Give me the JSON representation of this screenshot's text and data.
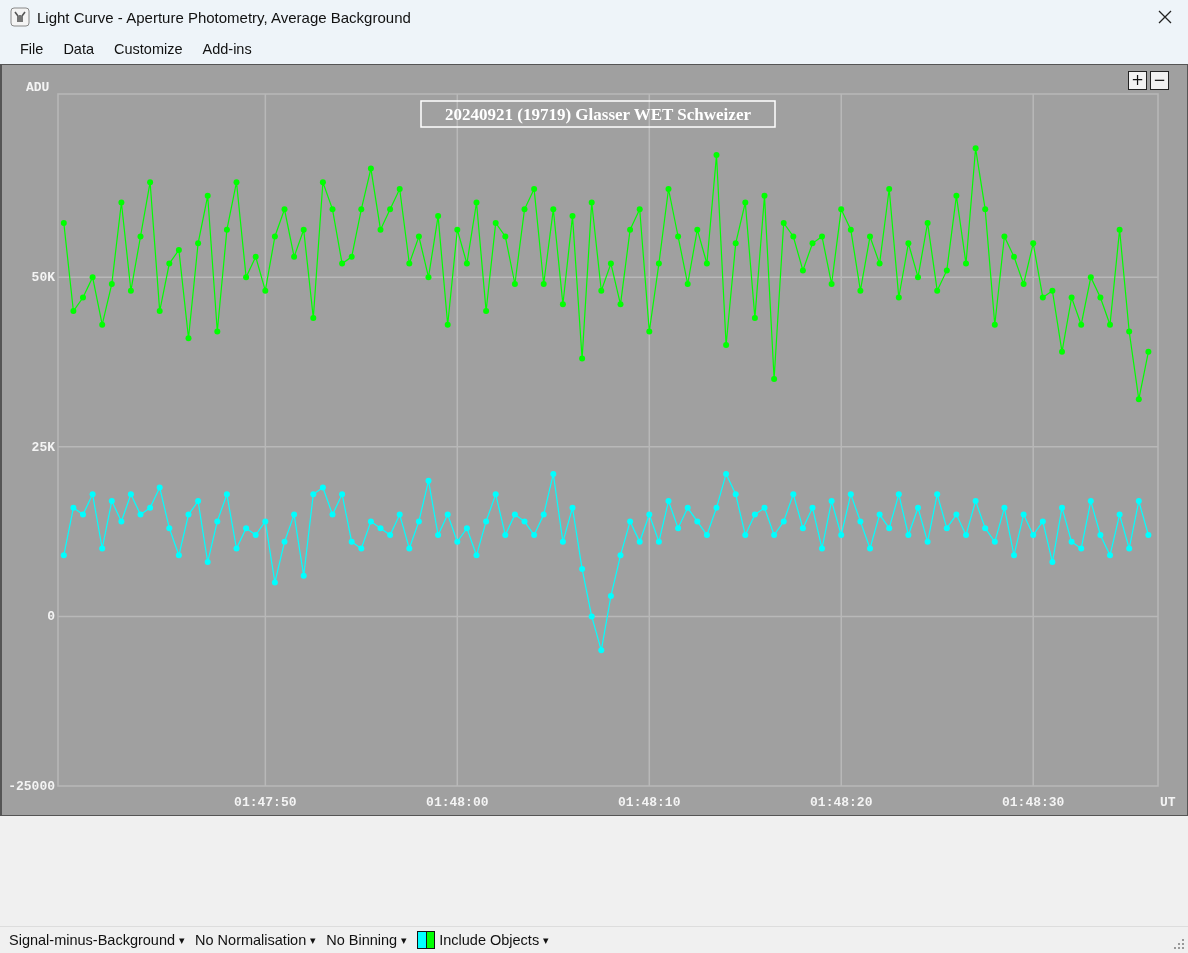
{
  "window": {
    "title": "Light Curve - Aperture Photometry, Average Background"
  },
  "menu": [
    {
      "label": "File"
    },
    {
      "label": "Data"
    },
    {
      "label": "Customize"
    },
    {
      "label": "Add-ins"
    }
  ],
  "plot": {
    "zoom_buttons": [
      "+",
      "−"
    ],
    "chart_data": {
      "type": "line",
      "title": "20240921 (19719) Glasser WET Schweizer",
      "xlabel": "UT",
      "grid": true,
      "ylabel": "ADU",
      "xlim": [
        6459.2,
        6516.5
      ],
      "ylim": [
        -25000,
        77000
      ],
      "xticks": [
        {
          "value": 6470,
          "label": "01:47:50"
        },
        {
          "value": 6480,
          "label": "01:48:00"
        },
        {
          "value": 6490,
          "label": "01:48:10"
        },
        {
          "value": 6500,
          "label": "01:48:20"
        },
        {
          "value": 6510,
          "label": "01:48:30"
        }
      ],
      "yticks": [
        {
          "value": -25000,
          "label": "-25000"
        },
        {
          "value": 0,
          "label": "0"
        },
        {
          "value": 25000,
          "label": "25K"
        },
        {
          "value": 50000,
          "label": "50K"
        }
      ],
      "x": [
        6459.5,
        6460,
        6460.5,
        6461,
        6461.5,
        6462,
        6462.5,
        6463,
        6463.5,
        6464,
        6464.5,
        6465,
        6465.5,
        6466,
        6466.5,
        6467,
        6467.5,
        6468,
        6468.5,
        6469,
        6469.5,
        6470,
        6470.5,
        6471,
        6471.5,
        6472,
        6472.5,
        6473,
        6473.5,
        6474,
        6474.5,
        6475,
        6475.5,
        6476,
        6476.5,
        6477,
        6477.5,
        6478,
        6478.5,
        6479,
        6479.5,
        6480,
        6480.5,
        6481,
        6481.5,
        6482,
        6482.5,
        6483,
        6483.5,
        6484,
        6484.5,
        6485,
        6485.5,
        6486,
        6486.5,
        6487,
        6487.5,
        6488,
        6488.5,
        6489,
        6489.5,
        6490,
        6490.5,
        6491,
        6491.5,
        6492,
        6492.5,
        6493,
        6493.5,
        6494,
        6494.5,
        6495,
        6495.5,
        6496,
        6496.5,
        6497,
        6497.5,
        6498,
        6498.5,
        6499,
        6499.5,
        6500,
        6500.5,
        6501,
        6501.5,
        6502,
        6502.5,
        6503,
        6503.5,
        6504,
        6504.5,
        6505,
        6505.5,
        6506,
        6506.5,
        6507,
        6507.5,
        6508,
        6508.5,
        6509,
        6509.5,
        6510,
        6510.5,
        6511,
        6511.5,
        6512,
        6512.5,
        6513,
        6513.5,
        6514,
        6514.5,
        6515,
        6515.5,
        6516
      ],
      "series": [
        {
          "color": "#00ff00",
          "marker": "circle",
          "values": [
            58000,
            45000,
            47000,
            50000,
            43000,
            49000,
            61000,
            48000,
            56000,
            64000,
            45000,
            52000,
            54000,
            41000,
            55000,
            62000,
            42000,
            57000,
            64000,
            50000,
            53000,
            48000,
            56000,
            60000,
            53000,
            57000,
            44000,
            64000,
            60000,
            52000,
            53000,
            60000,
            66000,
            57000,
            60000,
            63000,
            52000,
            56000,
            50000,
            59000,
            43000,
            57000,
            52000,
            61000,
            45000,
            58000,
            56000,
            49000,
            60000,
            63000,
            49000,
            60000,
            46000,
            59000,
            38000,
            61000,
            48000,
            52000,
            46000,
            57000,
            60000,
            42000,
            52000,
            63000,
            56000,
            49000,
            57000,
            52000,
            68000,
            40000,
            55000,
            61000,
            44000,
            62000,
            35000,
            58000,
            56000,
            51000,
            55000,
            56000,
            49000,
            60000,
            57000,
            48000,
            56000,
            52000,
            63000,
            47000,
            55000,
            50000,
            58000,
            48000,
            51000,
            62000,
            52000,
            69000,
            60000,
            43000,
            56000,
            53000,
            49000,
            55000,
            47000,
            48000,
            39000,
            47000,
            43000,
            50000,
            47000,
            43000,
            57000,
            42000,
            32000,
            39000
          ]
        },
        {
          "color": "#00ffff",
          "marker": "circle",
          "values": [
            9000,
            16000,
            15000,
            18000,
            10000,
            17000,
            14000,
            18000,
            15000,
            16000,
            19000,
            13000,
            9000,
            15000,
            17000,
            8000,
            14000,
            18000,
            10000,
            13000,
            12000,
            14000,
            5000,
            11000,
            15000,
            6000,
            18000,
            19000,
            15000,
            18000,
            11000,
            10000,
            14000,
            13000,
            12000,
            15000,
            10000,
            14000,
            20000,
            12000,
            15000,
            11000,
            13000,
            9000,
            14000,
            18000,
            12000,
            15000,
            14000,
            12000,
            15000,
            21000,
            11000,
            16000,
            7000,
            0,
            -5000,
            3000,
            9000,
            14000,
            11000,
            15000,
            11000,
            17000,
            13000,
            16000,
            14000,
            12000,
            16000,
            21000,
            18000,
            12000,
            15000,
            16000,
            12000,
            14000,
            18000,
            13000,
            16000,
            10000,
            17000,
            12000,
            18000,
            14000,
            10000,
            15000,
            13000,
            18000,
            12000,
            16000,
            11000,
            18000,
            13000,
            15000,
            12000,
            17000,
            13000,
            11000,
            16000,
            9000,
            15000,
            12000,
            14000,
            8000,
            16000,
            11000,
            10000,
            17000,
            12000,
            9000,
            15000,
            10000,
            17000,
            12000
          ]
        }
      ]
    }
  },
  "status_bar": [
    {
      "kind": "dropdown",
      "label": "Signal-minus-Background",
      "caret": "▾"
    },
    {
      "kind": "dropdown",
      "label": "No Normalisation",
      "caret": "▾"
    },
    {
      "kind": "dropdown",
      "label": "No Binning",
      "caret": "▾"
    },
    {
      "kind": "legend-dropdown",
      "label": "Include Objects",
      "caret": "▾"
    }
  ]
}
